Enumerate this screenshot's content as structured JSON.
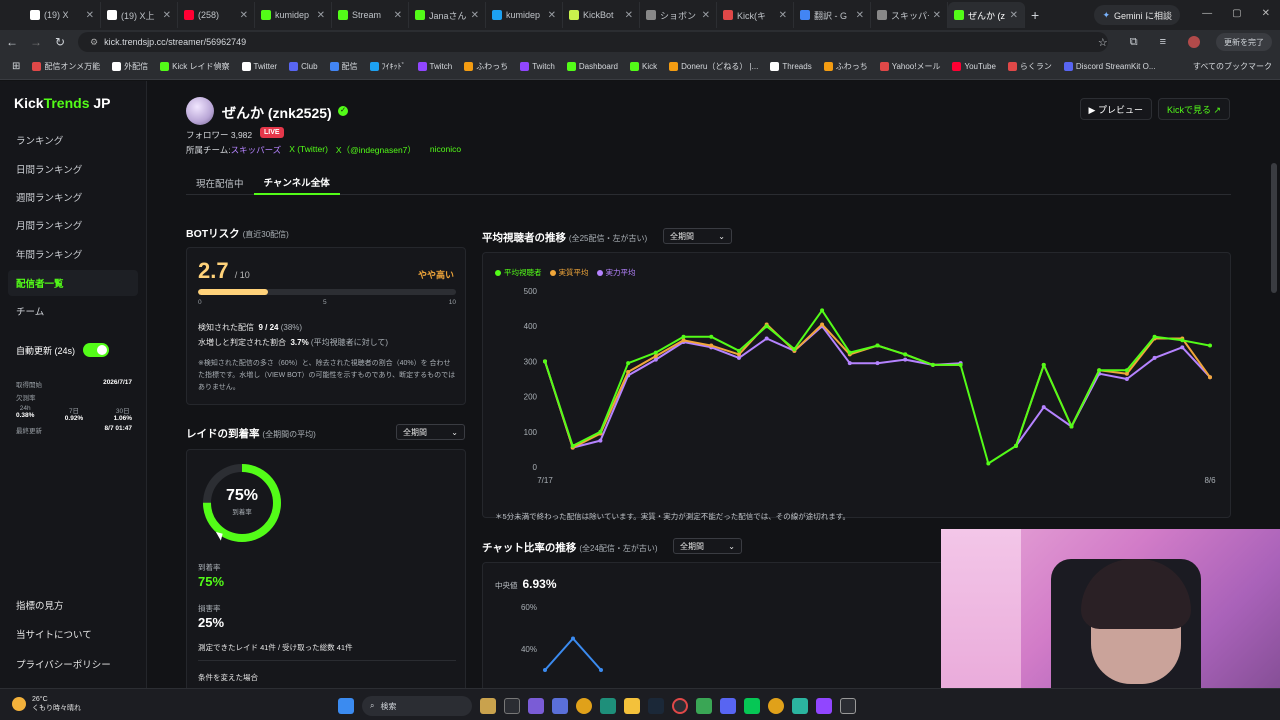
{
  "browser": {
    "tabs": [
      {
        "label": "(19) X",
        "color": "#ffffff"
      },
      {
        "label": "(19) X上",
        "color": "#ffffff"
      },
      {
        "label": "(258)",
        "color": "#ff0033"
      },
      {
        "label": "kumidep",
        "color": "#53fc18"
      },
      {
        "label": "Stream",
        "color": "#53fc18"
      },
      {
        "label": "Janaさん",
        "color": "#53fc18"
      },
      {
        "label": "kumidep",
        "color": "#1da1f2"
      },
      {
        "label": "KickBot",
        "color": "#c9f24d"
      },
      {
        "label": "ショボン",
        "color": "#888888"
      },
      {
        "label": "Kick(キ",
        "color": "#e04848"
      },
      {
        "label": "翻訳 - G",
        "color": "#4285f4"
      },
      {
        "label": "スキッパー",
        "color": "#888888"
      },
      {
        "label": "ぜんか (z",
        "color": "#53fc18"
      }
    ],
    "gemini_label": "Gemini に相談",
    "url": "kick.trendsjp.cc/streamer/56962749",
    "update_label": "更新を完了",
    "bookmarks": [
      "配信オンメ万能",
      "外配信",
      "Kick レイド偵察",
      "Twitter",
      "Club",
      "配信",
      "ﾌｲｷｯﾄﾞ",
      "Twitch",
      "ふわっち",
      "Twitch",
      "Dashboard",
      "Kick",
      "Doneru（どねる） |...",
      "Threads",
      "ふわっち",
      "Yahoo!メール",
      "YouTube",
      "らくラン",
      "Discord StreamKit O..."
    ],
    "bookmarks_all": "すべてのブックマーク"
  },
  "sidebar": {
    "brand_a": "Kick",
    "brand_b": "Trends",
    "brand_c": " JP",
    "items": [
      "ランキング",
      "日間ランキング",
      "週間ランキング",
      "月間ランキング",
      "年間ランキング",
      "配信者一覧",
      "チーム"
    ],
    "auto_update": "自動更新 (24s)",
    "stats": {
      "fetch_start_label": "取得開始",
      "fetch_start": "2026/7/17",
      "missing_label": "欠測率",
      "h24_label": "24h",
      "h24": "0.38%",
      "d7_label": "7日",
      "d7": "0.92%",
      "d30_label": "30日",
      "d30": "1.06%",
      "last_label": "最終更新",
      "last": "8/7 01:47"
    },
    "footer": [
      "指標の見方",
      "当サイトについて",
      "プライバシーポリシー"
    ]
  },
  "streamer": {
    "name": "ぜんか (znk2525)",
    "followers": "フォロワー 3,982",
    "live": "LIVE",
    "team_label": "所属チーム:",
    "team": "スキッパーズ",
    "links": [
      "X (Twitter)",
      "X（@indegnasen7）",
      "niconico"
    ],
    "preview_btn": "▶ プレビュー",
    "kick_btn": "Kickで見る ↗"
  },
  "tabs": [
    "現在配信中",
    "チャンネル全体"
  ],
  "bot_risk": {
    "title": "BOTリスク",
    "sub": "(直近30配信)",
    "score": "2.7",
    "of": "/ 10",
    "level": "やや高い",
    "fraction": 0.27,
    "ticks": [
      "0",
      "5",
      "10"
    ],
    "detected_label": "検知された配信",
    "detected": "9 / 24",
    "detected_pct": "(38%)",
    "ratio_label": "水増しと判定された割合",
    "ratio": "3.7%",
    "ratio_note": "(平均視聴者に対して)",
    "note": "※検知された配信の多さ（60%）と、除去された視聴者の割合（40%）を 合わせた指標です。水増し（VIEW BOT）の可能性を示すものであり、断定するものではありません。"
  },
  "raid": {
    "title": "レイドの到着率",
    "sub": "(全期間の平均)",
    "period": "全期間",
    "donut_value": "75%",
    "donut_sub": "到着率",
    "fraction": 0.75,
    "arrival_label": "到着率",
    "arrival": "75%",
    "loss_label": "損害率",
    "loss": "25%",
    "measured": "測定できたレイド 41件 / 受け取った総数 41件",
    "changed": "条件を変えた場合"
  },
  "viewers_chart": {
    "title": "平均視聴者の推移",
    "sub": "(全25配信・左が古い)",
    "period": "全期間",
    "note": "＊5分未満で終わった配信は除いています。実質・実力が測定不能だった配信では、その線が途切れます。"
  },
  "chat_chart": {
    "title": "チャット比率の推移",
    "sub": "(全24配信・左が古い)",
    "period": "全期間",
    "median_label": "中央値",
    "median": "6.93%"
  },
  "chart_data": [
    {
      "type": "line",
      "title": "平均視聴者の推移",
      "x": [
        "7/17",
        "",
        "",
        "",
        "",
        "",
        "",
        "",
        "",
        "",
        "",
        "",
        "",
        "",
        "",
        "",
        "",
        "",
        "",
        "",
        "",
        "",
        "",
        "",
        "8/6"
      ],
      "ylim": [
        0,
        500
      ],
      "yticks": [
        0,
        100,
        200,
        300,
        400,
        500
      ],
      "legend": "top-left",
      "grid": false,
      "series": [
        {
          "name": "平均視聴者",
          "color": "#53fc18",
          "values": [
            300,
            60,
            100,
            295,
            325,
            370,
            370,
            330,
            400,
            335,
            445,
            325,
            345,
            320,
            290,
            290,
            10,
            60,
            290,
            115,
            275,
            275,
            370,
            360,
            345
          ]
        },
        {
          "name": "実質平均",
          "color": "#f0a63a",
          "values": [
            300,
            55,
            95,
            270,
            315,
            360,
            345,
            320,
            405,
            330,
            405,
            320,
            345,
            320,
            290,
            290,
            null,
            60,
            290,
            115,
            275,
            265,
            365,
            365,
            255
          ]
        },
        {
          "name": "実力平均",
          "color": "#b583ff",
          "values": [
            300,
            55,
            75,
            260,
            305,
            355,
            340,
            310,
            365,
            330,
            400,
            295,
            295,
            305,
            290,
            295,
            null,
            60,
            170,
            115,
            265,
            250,
            310,
            340,
            255
          ]
        }
      ]
    },
    {
      "type": "line",
      "title": "チャット比率の推移",
      "ylim": [
        0,
        60
      ],
      "yticks": [
        "40%",
        "60%"
      ],
      "series": [
        {
          "name": "",
          "color": "#3b8bf0",
          "values": [
            30,
            45,
            30
          ]
        }
      ]
    }
  ],
  "taskbar": {
    "temp": "26°C",
    "weather": "くもり時々晴れ",
    "search": "検索"
  }
}
